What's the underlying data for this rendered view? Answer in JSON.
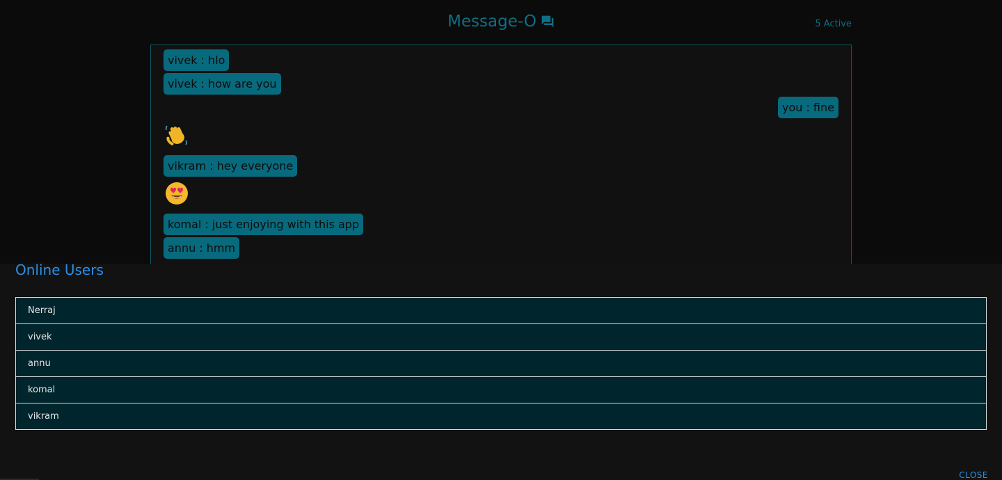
{
  "header": {
    "title": "Message-O",
    "title_icon": "chat-bubbles-icon",
    "active_count": "5 Active"
  },
  "messages": [
    {
      "text": "vivek : hlo",
      "side": "left"
    },
    {
      "text": "vivek : how are you",
      "side": "left"
    },
    {
      "text": "you : fine",
      "side": "right"
    },
    {
      "emoji": "waving-hand"
    },
    {
      "text": "vikram : hey everyone",
      "side": "left"
    },
    {
      "emoji": "heart-eyes-face"
    },
    {
      "text": "komal : just enjoying with this app",
      "side": "left"
    },
    {
      "text": "annu : hmm",
      "side": "left"
    }
  ],
  "online_users": {
    "title": "Online Users",
    "users": [
      "Nerraj",
      "vivek",
      "annu",
      "komal",
      "vikram"
    ],
    "close_label": "CLOSE"
  },
  "colors": {
    "accent": "#0e6f85",
    "bubble": "#086a7d",
    "link": "#2b8fe8",
    "list_row": "#00252d"
  }
}
